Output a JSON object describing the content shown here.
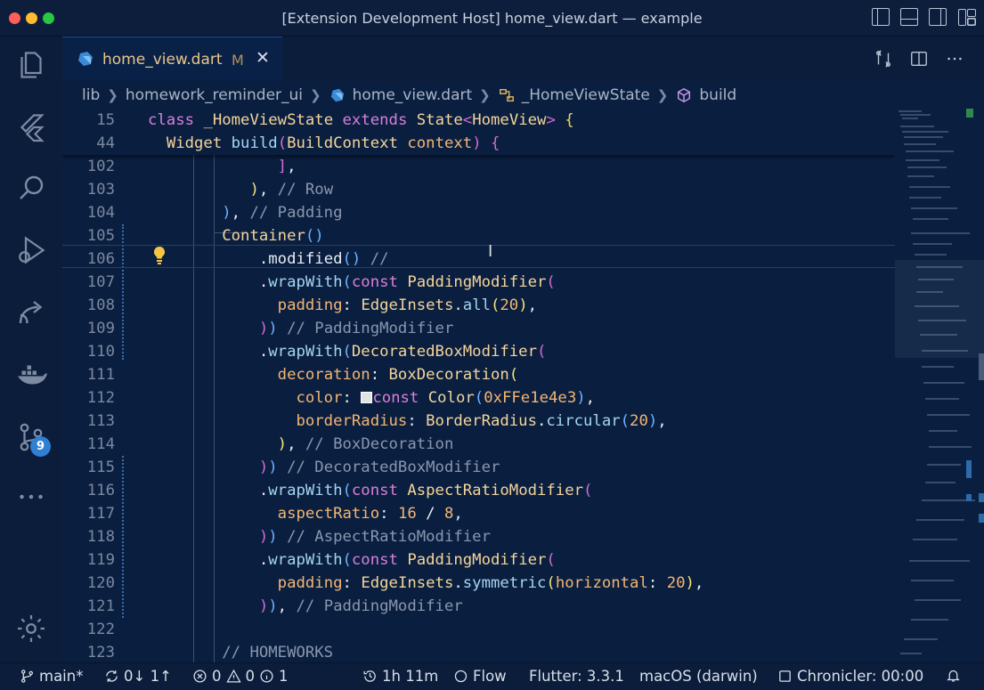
{
  "window": {
    "title": "[Extension Development Host] home_view.dart — example"
  },
  "activity_bar": {
    "items": [
      "explorer-icon",
      "flutter-icon",
      "search-icon",
      "run-debug-icon",
      "live-share-icon",
      "docker-icon",
      "source-control-icon",
      "more-icon",
      "settings-icon"
    ],
    "source_control_badge": "9"
  },
  "tab": {
    "filename": "home_view.dart",
    "status": "M",
    "close": "✕"
  },
  "breadcrumb": {
    "items": [
      "lib",
      "homework_reminder_ui",
      "home_view.dart",
      "_HomeViewState",
      "build"
    ]
  },
  "editor": {
    "sticky_line_numbers": [
      "15",
      "44"
    ],
    "line_numbers": [
      "102",
      "103",
      "104",
      "105",
      "106",
      "107",
      "108",
      "109",
      "110",
      "111",
      "112",
      "113",
      "114",
      "115",
      "116",
      "117",
      "118",
      "119",
      "120",
      "121",
      "122",
      "123"
    ],
    "color_swatch": "#e1e4e3"
  },
  "status_bar": {
    "branch": "main*",
    "sync": "0↓ 1↑",
    "errors": "0",
    "warnings": "0",
    "infos": "1",
    "time_tracker": "1h 11m",
    "flow": "Flow",
    "flutter": "Flutter: 3.3.1",
    "device": "macOS (darwin)",
    "chronicler": "Chronicler: 00:00"
  },
  "colors": {
    "editor_bg": "#0a1f40",
    "keyword": "#d87fd7",
    "type": "#f4d49a",
    "number": "#f3b574",
    "comment": "#8a96ad",
    "badge": "#2f7fd2"
  }
}
